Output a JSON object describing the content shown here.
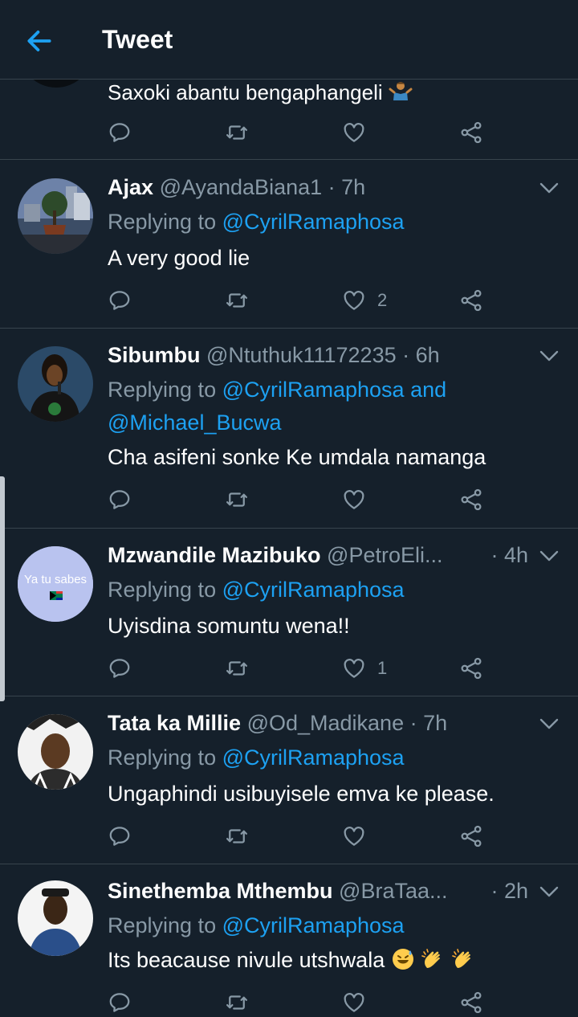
{
  "header": {
    "title": "Tweet"
  },
  "partial_tweet": {
    "text": "Saxoki abantu bengaphangeli"
  },
  "tweets": [
    {
      "name": "Ajax",
      "handle": "@AyandaBiana1",
      "sep": " · ",
      "time": "7h",
      "replying_prefix": "Replying to ",
      "mentions": "@CyrilRamaphosa",
      "text": "A very good lie",
      "likes": "2"
    },
    {
      "name": "Sibumbu",
      "handle": "@Ntuthuk11172235",
      "sep": " · ",
      "time": "6h",
      "replying_prefix": "Replying to ",
      "mentions": "@CyrilRamaphosa and",
      "mentions_line2": "@Michael_Bucwa",
      "text": "Cha asifeni sonke Ke umdala namanga",
      "likes": ""
    },
    {
      "name": "Mzwandile Mazibuko",
      "handle": "@PetroEli...",
      "sep": "·",
      "time": "4h",
      "avatar_text": "Ya tu sabes",
      "replying_prefix": "Replying to ",
      "mentions": "@CyrilRamaphosa",
      "text": "Uyisdina somuntu wena!!",
      "likes": "1"
    },
    {
      "name": "Tata ka Millie",
      "handle": "@Od_Madikane",
      "sep": " · ",
      "time": "7h",
      "replying_prefix": "Replying to ",
      "mentions": "@CyrilRamaphosa",
      "text": "Ungaphindi usibuyisele emva ke please.",
      "likes": ""
    },
    {
      "name": "Sinethemba Mthembu",
      "handle": "@BraTaa...",
      "sep": "·",
      "time": "2h",
      "replying_prefix": "Replying to ",
      "mentions": "@CyrilRamaphosa",
      "text": "Its beacause nivule utshwala",
      "likes": ""
    }
  ],
  "colors": {
    "background": "#15202b",
    "accent": "#1da1f2",
    "muted": "#8899a6",
    "divider": "#38444d"
  },
  "icons": {
    "back": "arrow-left-icon",
    "reply": "reply-icon",
    "retweet": "retweet-icon",
    "like": "heart-icon",
    "share": "share-icon",
    "more": "chevron-down-icon"
  }
}
